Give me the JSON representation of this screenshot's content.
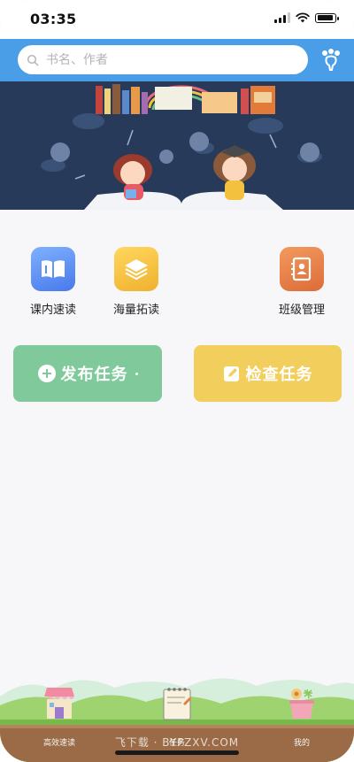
{
  "status_bar": {
    "time": "03:35"
  },
  "search": {
    "placeholder": "书名、作者"
  },
  "menu": [
    {
      "label": "课内速读",
      "icon": "book-icon",
      "color": "#5b8df3"
    },
    {
      "label": "海量拓读",
      "icon": "layers-icon",
      "color": "#f4c13f"
    },
    {
      "label": "班级管理",
      "icon": "contacts-icon",
      "color": "#e77c44"
    }
  ],
  "actions": {
    "publish_label": "发布任务",
    "check_label": "检查任务"
  },
  "tabs": [
    {
      "label": "高效速读",
      "icon": "shop-house-icon"
    },
    {
      "label": "任务",
      "icon": "task-notebook-icon"
    },
    {
      "label": "我的",
      "icon": "flower-pot-icon"
    }
  ],
  "watermark": "飞下载 · BYFZXV.COM",
  "colors": {
    "header": "#4a9ee8",
    "publish": "#7fc99a",
    "check": "#f2cf5c",
    "banner": "#283a5a"
  }
}
